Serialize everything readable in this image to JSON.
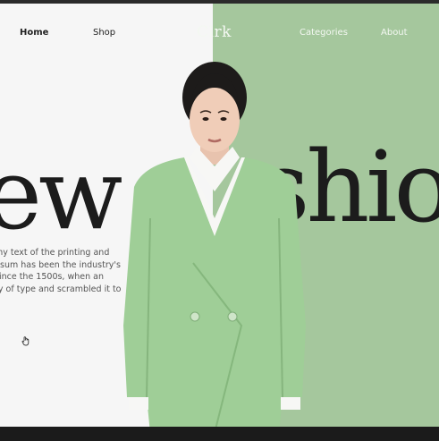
{
  "nav": {
    "home": "Home",
    "shop": "Shop",
    "logo": "Clrk",
    "categories": "Categories",
    "about": "About"
  },
  "hero": {
    "headline_left": "ew",
    "headline_right": "shio",
    "paragraph_lines": [
      "my text of the printing and",
      "psum has been the industry's",
      "since the 1500s, when an",
      "ry of type and scrambled it to",
      "."
    ]
  },
  "colors": {
    "left_background": "#f6f6f6",
    "right_background": "#a5c79d",
    "jacket": "#9fce97",
    "text_dark": "#1c1c1c"
  },
  "icons": {
    "cursor": "hand-pointer-icon"
  }
}
